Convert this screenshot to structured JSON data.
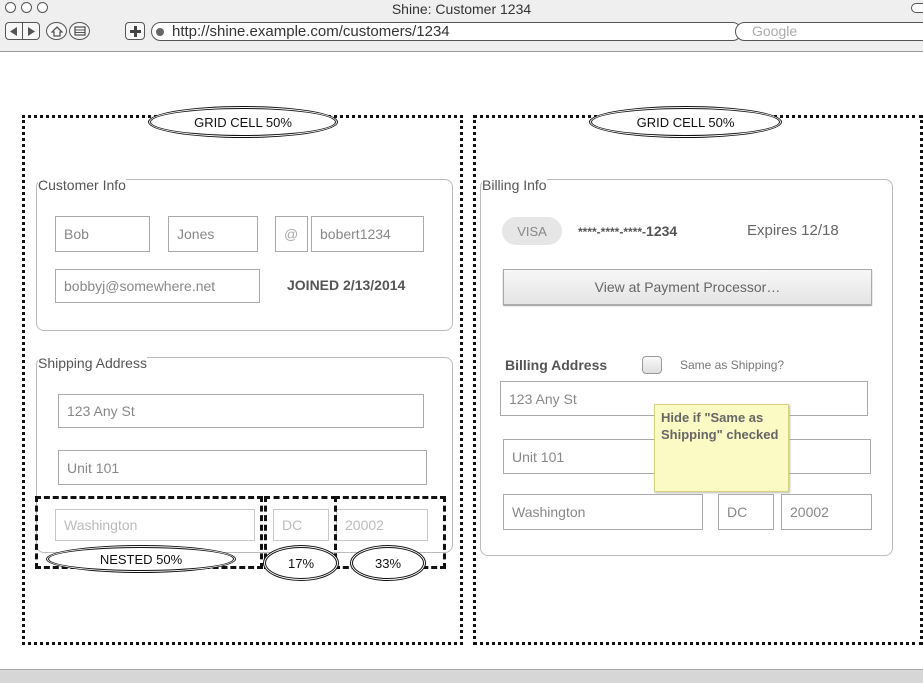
{
  "window": {
    "title": "Shine: Customer 1234",
    "url": "http://shine.example.com/customers/1234",
    "search_placeholder": "Google",
    "nav_icons": [
      "back-arrow-icon",
      "forward-arrow-icon",
      "home-icon",
      "bookmarks-icon",
      "add-tab-icon",
      "globe-icon"
    ]
  },
  "grid": {
    "left_label": "GRID CELL 50%",
    "right_label": "GRID CELL 50%"
  },
  "customer_info": {
    "legend": "Customer Info",
    "first_name": "Bob",
    "last_name": "Jones",
    "at_symbol": "@",
    "username": "bobert1234",
    "email": "bobbyj@somewhere.net",
    "joined": "JOINED 2/13/2014"
  },
  "shipping": {
    "legend": "Shipping Address",
    "street": "123 Any St",
    "unit": "Unit 101",
    "city": "Washington",
    "state": "DC",
    "zip": "20002"
  },
  "nested_labels": {
    "city": "NESTED 50%",
    "state": "17%",
    "zip": "33%"
  },
  "billing_info": {
    "legend": "Billing Info",
    "card_type": "VISA",
    "card_mask": "****-****-****-",
    "card_last4": "1234",
    "expires": "Expires 12/18",
    "processor_button": "View at Payment Processor…"
  },
  "billing_address": {
    "heading": "Billing Address",
    "same_as_shipping": "Same as Shipping?",
    "street": "123 Any St",
    "unit": "Unit 101",
    "city": "Washington",
    "state": "DC",
    "zip": "20002"
  },
  "note": {
    "text": "Hide if \"Same as Shipping\" checked"
  }
}
